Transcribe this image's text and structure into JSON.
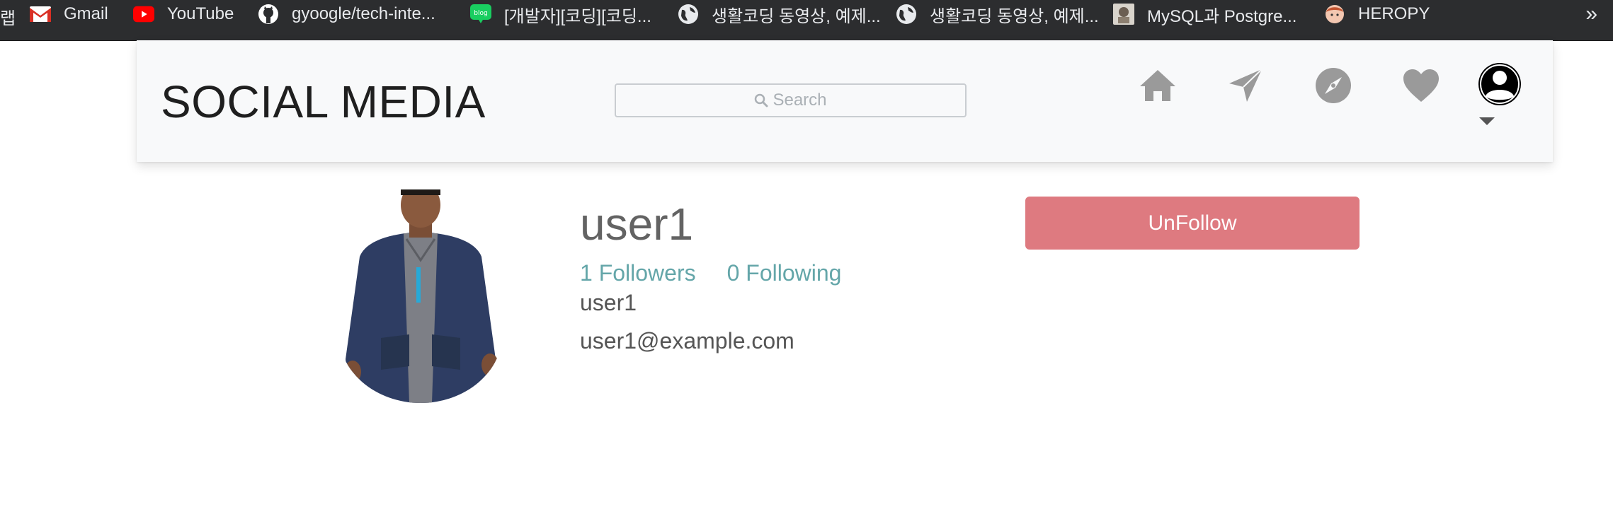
{
  "bookmarks": {
    "cut_text": "랩",
    "items": [
      {
        "label": "Gmail",
        "icon": "gmail-icon"
      },
      {
        "label": "YouTube",
        "icon": "youtube-icon"
      },
      {
        "label": "gyoogle/tech-inte...",
        "icon": "github-icon"
      },
      {
        "label": "[개발자][코딩][코딩...",
        "icon": "blog-icon"
      },
      {
        "label": "생활코딩 동영상, 예제...",
        "icon": "globe-icon"
      },
      {
        "label": "생활코딩 동영상, 예제...",
        "icon": "globe-icon"
      },
      {
        "label": "MySQL과 Postgre...",
        "icon": "site-thumbnail-icon"
      },
      {
        "label": "HEROPY",
        "icon": "heropy-icon"
      }
    ],
    "more": "»"
  },
  "navbar": {
    "brand": "SOCIAL MEDIA",
    "search_placeholder": "Search",
    "icons": [
      "home-icon",
      "send-icon",
      "explore-icon",
      "heart-icon",
      "profile-icon"
    ]
  },
  "profile": {
    "username": "user1",
    "followers": "1 Followers",
    "following": "0 Following",
    "name": "user1",
    "email": "user1@example.com",
    "unfollow_label": "UnFollow"
  },
  "colors": {
    "bookmarks_bg": "#2c2d2f",
    "navbar_bg": "#f8f9fa",
    "link": "#64a6a9",
    "unfollow_bg": "#de7a80",
    "nav_icon": "#9a9a9a"
  }
}
